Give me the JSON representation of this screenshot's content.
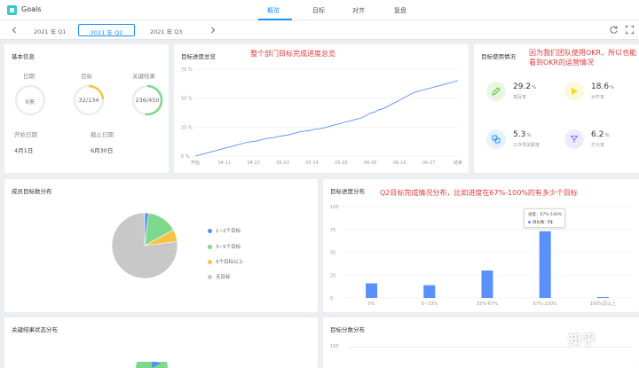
{
  "app": {
    "title": "Goals"
  },
  "nav": {
    "tabs": [
      "概览",
      "目标",
      "对齐",
      "复盘"
    ],
    "active_index": 0
  },
  "quarters": {
    "items": [
      "2021 年 Q1",
      "2021 年 Q2",
      "2021 年 Q3"
    ],
    "active_index": 1
  },
  "basic_info": {
    "title": "基本信息",
    "period": {
      "label": "日期",
      "value": "0天"
    },
    "goal": {
      "label": "目标",
      "value": "32/134",
      "fraction": 0.239
    },
    "kr": {
      "label": "关键结果",
      "value": "236/450",
      "fraction": 0.524
    },
    "start": {
      "label": "开始日期",
      "value": "4月1日"
    },
    "end": {
      "label": "截止日期",
      "value": "6月30日"
    }
  },
  "progress_overview": {
    "title": "目标进度总览",
    "annotation": "整个部门目标完成进度总览"
  },
  "usage": {
    "title": "目标使用情况",
    "annotation": "因为我们团队使用OKR，所以也能看到OKR的运营情况",
    "items": [
      {
        "value": "29.2",
        "unit": "%",
        "label": "填写率",
        "icon": "pencil-icon",
        "color": "#52c41a",
        "bg": "#e8f7e2"
      },
      {
        "value": "18.6",
        "unit": "%",
        "label": "对齐率",
        "icon": "flag-icon",
        "color": "#fadb14",
        "bg": "#fdf7dc"
      },
      {
        "value": "5.3",
        "unit": "%",
        "label": "工作项关联率",
        "icon": "link-icon",
        "color": "#1890ff",
        "bg": "#e6f1fd"
      },
      {
        "value": "6.2",
        "unit": "%",
        "label": "打分率",
        "icon": "award-icon",
        "color": "#8c6cf0",
        "bg": "#efebfd"
      }
    ]
  },
  "member_dist": {
    "title": "成员目标数分布"
  },
  "goal_progress": {
    "title": "目标进度分布",
    "annotation": "Q2目标完成情况分布，比如进度在67%-100%的有多少个目标",
    "tooltip": {
      "title": "进度：67%-100%",
      "series": "目标数",
      "value": "73"
    }
  },
  "kr_status": {
    "title": "关键结果状态分布"
  },
  "score_dist": {
    "title": "目标分数分布"
  },
  "watermark": "知乎",
  "chart_data": [
    {
      "type": "line",
      "title": "目标进度总览",
      "x_ticks": [
        "开始",
        "04-11",
        "04-22",
        "05-03",
        "05-14",
        "05-25",
        "06-05",
        "06-16",
        "06-27",
        "结束"
      ],
      "y_ticks": [
        "0 %",
        "25 %",
        "50 %",
        "75 %"
      ],
      "ylim": [
        0,
        75
      ],
      "unit": "%",
      "color": "#5b8ff9",
      "series": [
        {
          "values": [
            0,
            1,
            2,
            3,
            4,
            5,
            6,
            7,
            8,
            9,
            10,
            11,
            12,
            12.5,
            13,
            14,
            15,
            15.5,
            16,
            17,
            17.5,
            18,
            19,
            20,
            21,
            21.5,
            22,
            23,
            23.5,
            24,
            25,
            26,
            27,
            28,
            29,
            30,
            31,
            32,
            33,
            35,
            37,
            38,
            40,
            41,
            43,
            45,
            47,
            49,
            51,
            53,
            55,
            56,
            57,
            58,
            59,
            60,
            61,
            62,
            63,
            64,
            65
          ]
        }
      ],
      "grid": true
    },
    {
      "type": "pie",
      "title": "成员目标数分布",
      "legend_position": "right",
      "series": [
        {
          "name": "1~2个目标",
          "value": 2,
          "color": "#5b8ff9"
        },
        {
          "name": "3~5个目标",
          "value": 15,
          "color": "#7dd98c"
        },
        {
          "name": "5个目标以上",
          "value": 6,
          "color": "#f6c342"
        },
        {
          "name": "无目标",
          "value": 77,
          "color": "#c8c8c8"
        }
      ]
    },
    {
      "type": "bar",
      "title": "目标进度分布",
      "categories": [
        "0%",
        "0~33%",
        "33%-67%",
        "67%-100%",
        "100%及以上"
      ],
      "values": [
        16,
        14,
        30,
        73,
        1
      ],
      "y_ticks": [
        "0",
        "25",
        "50",
        "75",
        "100"
      ],
      "ylim": [
        0,
        100
      ],
      "color": "#5b8ff9"
    },
    {
      "type": "pie",
      "title": "关键结果状态分布",
      "series": []
    },
    {
      "type": "bar",
      "title": "目标分数分布",
      "y_ticks": [
        "150"
      ],
      "values": []
    }
  ]
}
